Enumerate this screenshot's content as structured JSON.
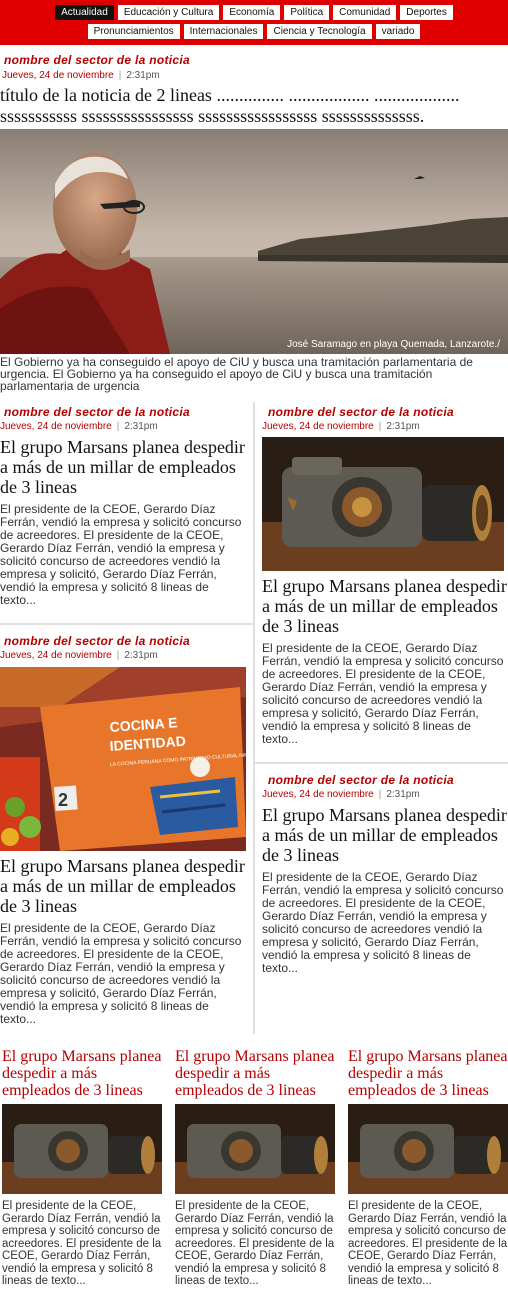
{
  "nav": {
    "row1": [
      "Actualidad",
      "Educación y Cultura",
      "Economía",
      "Política",
      "Comunidad",
      "Deportes"
    ],
    "row2": [
      "Pronunciamientos",
      "Internacionales",
      "Ciencia y Tecnología",
      "variado"
    ],
    "active": "Actualidad"
  },
  "hero": {
    "sector": "nombre del sector de la noticia",
    "date": "Jueves, 24 de noviembre",
    "time": "2:31pm",
    "title_line1": "título de la noticia de 2 lineas ............... .................. ...................",
    "title_line2": "sssssssssss ssssssssssssssss sssssssssssssssss ssssssssssssss.",
    "caption": "José Saramago en playa Quemada, Lanzarote./",
    "body": "El Gobierno ya ha conseguido el apoyo de CiU y busca una tramitación parlamentaria de urgencia. El Gobierno ya ha conseguido el apoyo de CiU y busca una tramitación parlamentaria de urgencia"
  },
  "cards": [
    {
      "sector": "nombre del sector de la noticia",
      "date": "Jueves, 24 de noviembre",
      "time": "2:31pm",
      "title": "El grupo Marsans planea despedir a más de un millar de empleados de 3 lineas",
      "body": "El presidente de la CEOE, Gerardo Díaz Ferrán, vendió la empresa y solicitó concurso de acreedores. El presidente de la CEOE, Gerardo Díaz Ferrán, vendió la empresa y solicitó concurso de acreedores vendió la empresa y solicitó, Gerardo Díaz Ferrán, vendió la empresa y solicitó 8 lineas de texto..."
    },
    {
      "sector": "nombre del sector de la noticia",
      "date": "Jueves, 24 de noviembre",
      "time": "2:31pm",
      "title": "El grupo Marsans planea despedir a más de un millar de empleados de 3 lineas",
      "body": "El presidente de la CEOE, Gerardo Díaz Ferrán, vendió la empresa y solicitó concurso de acreedores. El presidente de la CEOE, Gerardo Díaz Ferrán, vendió la empresa y solicitó concurso de acreedores vendió la empresa y solicitó, Gerardo Díaz Ferrán, vendió la empresa y solicitó 8 lineas de texto..."
    },
    {
      "sector": "nombre del sector de la noticia",
      "date": "Jueves, 24 de noviembre",
      "time": "2:31pm",
      "title": "El grupo Marsans planea despedir a más de un millar de empleados de 3 lineas",
      "body": "El presidente de la CEOE, Gerardo Díaz Ferrán, vendió la empresa y solicitó concurso de acreedores. El presidente de la CEOE, Gerardo Díaz Ferrán, vendió la empresa y solicitó concurso de acreedores vendió la empresa y solicitó, Gerardo Díaz Ferrán, vendió la empresa y solicitó 8 lineas de texto..."
    },
    {
      "sector": "nombre del sector de la noticia",
      "date": "Jueves, 24 de noviembre",
      "time": "2:31pm",
      "title": "El grupo Marsans planea despedir a más de un millar de empleados de 3 lineas",
      "body": "El presidente de la CEOE, Gerardo Díaz Ferrán, vendió la empresa y solicitó concurso de acreedores. El presidente de la CEOE, Gerardo Díaz Ferrán, vendió la empresa y solicitó concurso de acreedores vendió la empresa y solicitó, Gerardo Díaz Ferrán, vendió la empresa y solicitó 8 lineas de texto..."
    }
  ],
  "book_cover": {
    "line1": "COCINA E",
    "line2": "IDENTIDAD",
    "subtitle": "LA COCINA PERUANA COMO PATRIMONIO CULTURAL INMATERIAL",
    "number": "2"
  },
  "bottom": [
    {
      "title": "El grupo Marsans planea despedir a más empleados de 3 lineas",
      "body": "El presidente de la CEOE, Gerardo Díaz Ferrán, vendió la empresa y solicitó concurso de acreedores. El presidente de la CEOE, Gerardo Díaz Ferrán, vendió la empresa y solicitó 8 lineas de texto..."
    },
    {
      "title": "El grupo Marsans planea despedir a más empleados de 3 lineas",
      "body": "El presidente de la CEOE, Gerardo Díaz Ferrán, vendió la empresa y solicitó concurso de acreedores. El presidente de la CEOE, Gerardo Díaz Ferrán, vendió la empresa y solicitó 8 lineas de texto..."
    },
    {
      "title": "El grupo Marsans planea despedir a más empleados de 3 lineas",
      "body": "El presidente de la CEOE, Gerardo Díaz Ferrán, vendió la empresa y solicitó concurso de acreedores. El presidente de la CEOE, Gerardo Díaz Ferrán, vendió la empresa y solicitó 8 lineas de texto..."
    }
  ],
  "colors": {
    "accent": "#e00000",
    "sector": "#b50000"
  }
}
